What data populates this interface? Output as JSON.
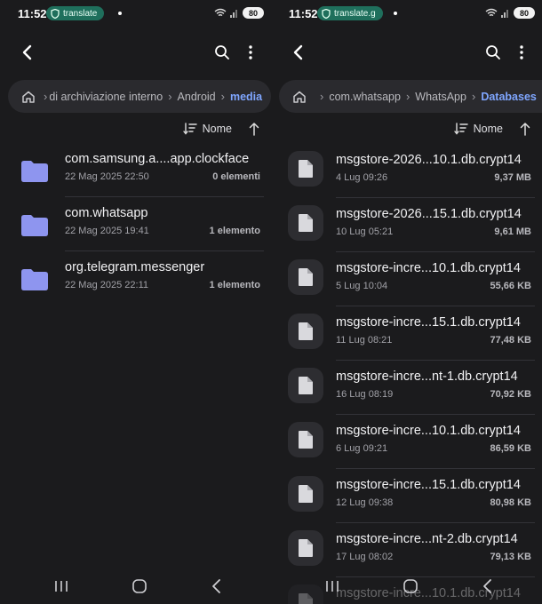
{
  "colors": {
    "background": "#1b1b1d",
    "breadcrumb_bg": "#2a2a2e",
    "accent": "#7fa6ff",
    "folder": "#8e95ef",
    "pill": "#1f6f5c"
  },
  "left": {
    "status": {
      "time": "11:52",
      "pill": "translate",
      "battery": "80"
    },
    "breadcrumb": [
      "di archiviazione interno",
      "Android",
      "media"
    ],
    "sort_label": "Nome",
    "items": [
      {
        "name": "com.samsung.a....app.clockface",
        "date": "22 Mag 2025 22:50",
        "meta": "0 elementi",
        "icon": "folder-icon"
      },
      {
        "name": "com.whatsapp",
        "date": "22 Mag 2025 19:41",
        "meta": "1 elemento",
        "icon": "folder-icon"
      },
      {
        "name": "org.telegram.messenger",
        "date": "22 Mag 2025 22:11",
        "meta": "1 elemento",
        "icon": "folder-icon"
      }
    ]
  },
  "right": {
    "status": {
      "time": "11:52",
      "pill": "translate.g",
      "battery": "80"
    },
    "breadcrumb": [
      "com.whatsapp",
      "WhatsApp",
      "Databases"
    ],
    "sort_label": "Nome",
    "items": [
      {
        "name": "msgstore-2026...10.1.db.crypt14",
        "date": "4 Lug 09:26",
        "meta": "9,37 MB",
        "icon": "file-icon"
      },
      {
        "name": "msgstore-2026...15.1.db.crypt14",
        "date": "10 Lug 05:21",
        "meta": "9,61 MB",
        "icon": "file-icon"
      },
      {
        "name": "msgstore-incre...10.1.db.crypt14",
        "date": "5 Lug 10:04",
        "meta": "55,66 KB",
        "icon": "file-icon"
      },
      {
        "name": "msgstore-incre...15.1.db.crypt14",
        "date": "11 Lug 08:21",
        "meta": "77,48 KB",
        "icon": "file-icon"
      },
      {
        "name": "msgstore-incre...nt-1.db.crypt14",
        "date": "16 Lug 08:19",
        "meta": "70,92 KB",
        "icon": "file-icon"
      },
      {
        "name": "msgstore-incre...10.1.db.crypt14",
        "date": "6 Lug 09:21",
        "meta": "86,59 KB",
        "icon": "file-icon"
      },
      {
        "name": "msgstore-incre...15.1.db.crypt14",
        "date": "12 Lug 09:38",
        "meta": "80,98 KB",
        "icon": "file-icon"
      },
      {
        "name": "msgstore-incre...nt-2.db.crypt14",
        "date": "17 Lug 08:02",
        "meta": "79,13 KB",
        "icon": "file-icon"
      },
      {
        "name": "msgstore-incre...10.1.db.crypt14",
        "date": "",
        "meta": "",
        "icon": "file-icon"
      }
    ]
  }
}
